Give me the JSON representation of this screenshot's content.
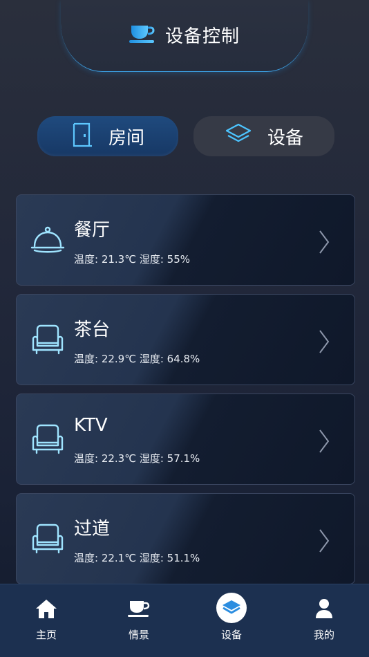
{
  "header": {
    "title": "设备控制",
    "icon": "teacup-icon"
  },
  "tabs": [
    {
      "label": "房间",
      "icon": "door-icon",
      "active": true
    },
    {
      "label": "设备",
      "icon": "layers-icon",
      "active": false
    }
  ],
  "rooms": [
    {
      "name": "餐厅",
      "stats": "温度: 21.3℃ 湿度: 55%",
      "icon": "cloche-icon"
    },
    {
      "name": "茶台",
      "stats": "温度: 22.9℃ 湿度: 64.8%",
      "icon": "armchair-icon"
    },
    {
      "name": "KTV",
      "stats": "温度: 22.3℃ 湿度: 57.1%",
      "icon": "armchair-icon"
    },
    {
      "name": "过道",
      "stats": "温度: 22.1℃ 湿度: 51.1%",
      "icon": "armchair-icon"
    }
  ],
  "nav": [
    {
      "label": "主页",
      "icon": "home-icon"
    },
    {
      "label": "情景",
      "icon": "teacup-icon"
    },
    {
      "label": "设备",
      "icon": "layers-icon",
      "active": true
    },
    {
      "label": "我的",
      "icon": "person-icon"
    }
  ],
  "colors": {
    "accent": "#3da3e8",
    "active_tab": "#1f4a7e",
    "nav_bg": "#1c3050",
    "icon_glow": "#9fe4ff"
  }
}
